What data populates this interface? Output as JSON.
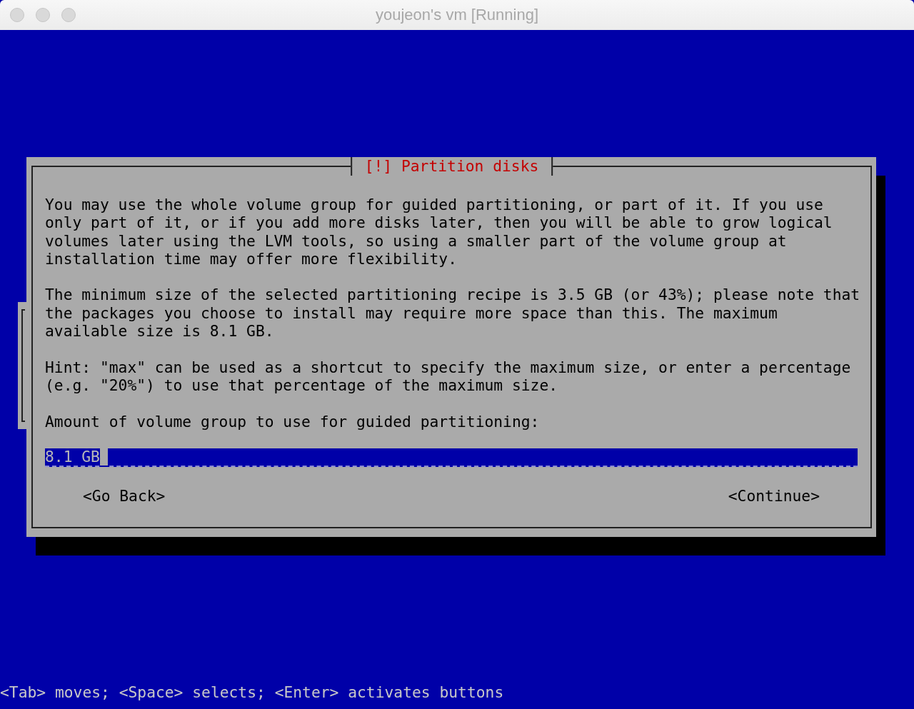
{
  "window": {
    "title": "youjeon's vm [Running]"
  },
  "dialog": {
    "title": "[!] Partition disks",
    "paragraphs": [
      [
        "You may use the whole volume group for guided partitioning, or part of it. If you use",
        "only part of it, or if you add more disks later, then you will be able to grow logical",
        "volumes later using the LVM tools, so using a smaller part of the volume group at",
        "installation time may offer more flexibility."
      ],
      [
        "The minimum size of the selected partitioning recipe is 3.5 GB (or 43%); please note that",
        "the packages you choose to install may require more space than this. The maximum",
        "available size is 8.1 GB."
      ],
      [
        "Hint: \"max\" can be used as a shortcut to specify the maximum size, or enter a percentage",
        "(e.g. \"20%\") to use that percentage of the maximum size."
      ]
    ],
    "prompt": "Amount of volume group to use for guided partitioning:",
    "input": {
      "value": "8.1 GB"
    },
    "buttons": [
      {
        "label": "<Go Back>"
      },
      {
        "label": "<Continue>"
      }
    ]
  },
  "help_line": "<Tab> moves; <Space> selects; <Enter> activates buttons"
}
